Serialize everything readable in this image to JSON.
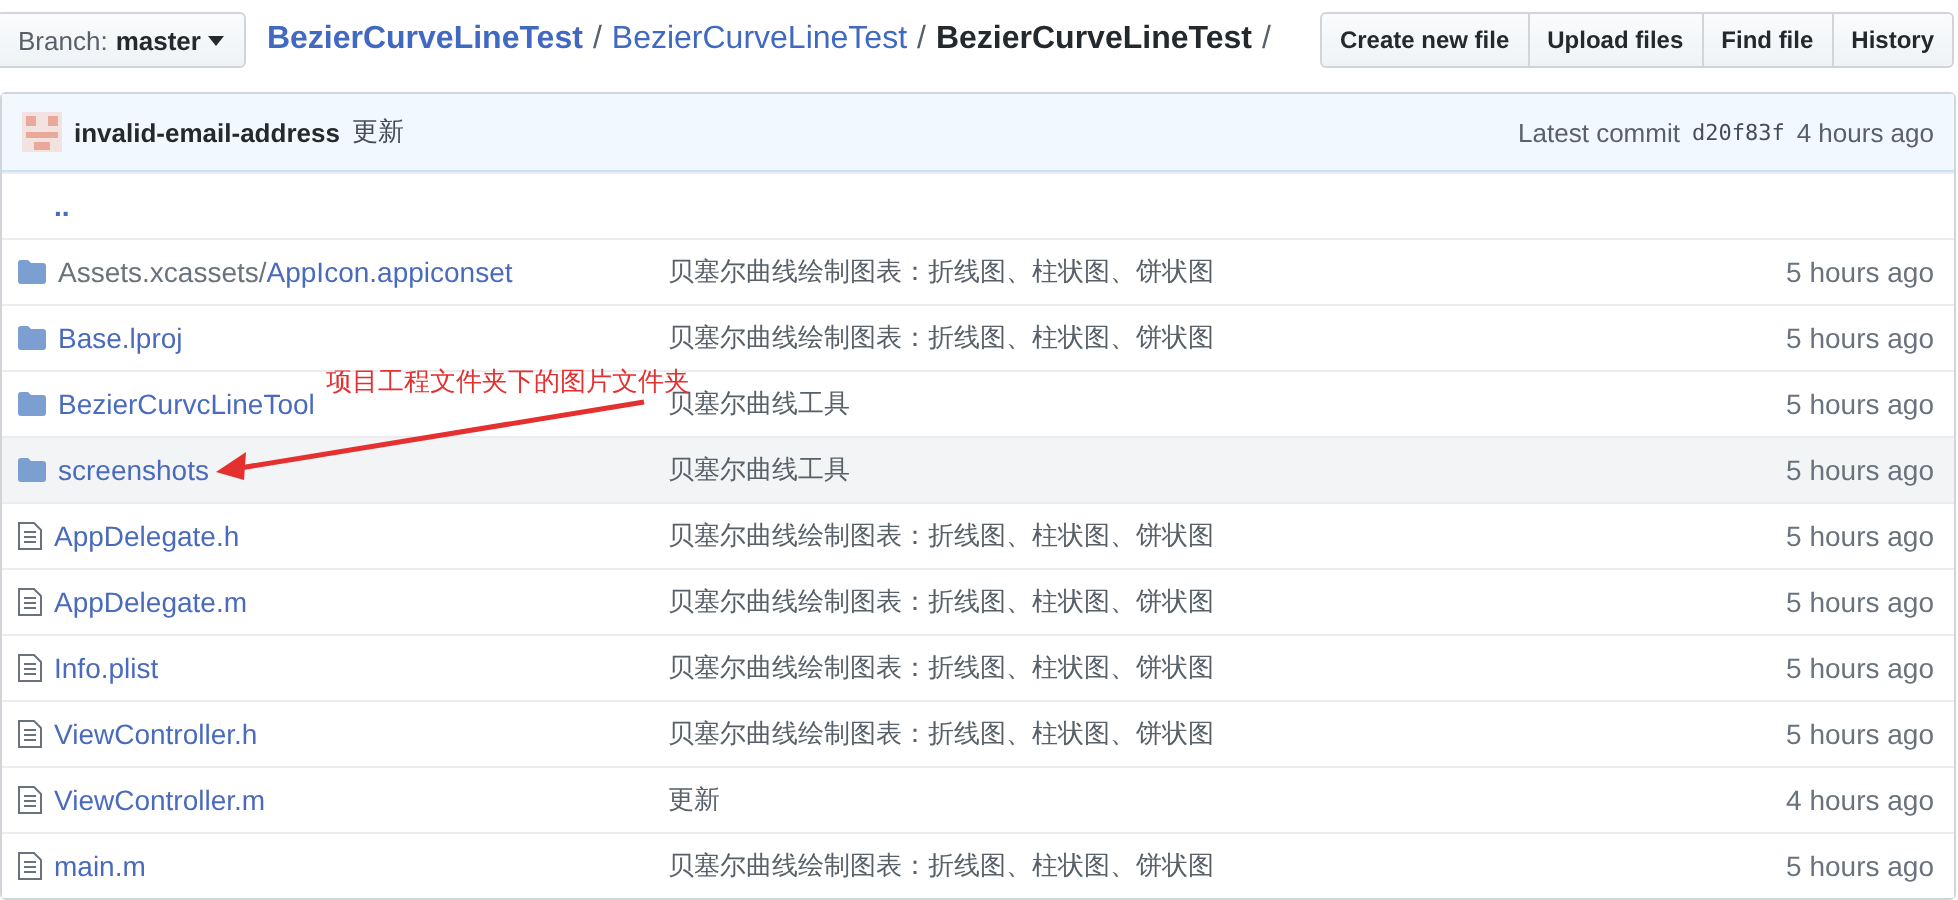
{
  "branch": {
    "label": "Branch:",
    "value": "master"
  },
  "breadcrumb": [
    {
      "text": "BezierCurveLineTest",
      "kind": "link"
    },
    {
      "text": "/",
      "kind": "sep"
    },
    {
      "text": "BezierCurveLineTest",
      "kind": "link"
    },
    {
      "text": "/",
      "kind": "sep"
    },
    {
      "text": "BezierCurveLineTest",
      "kind": "current"
    },
    {
      "text": "/",
      "kind": "sep"
    }
  ],
  "actions": [
    "Create new file",
    "Upload files",
    "Find file",
    "History"
  ],
  "commit": {
    "author": "invalid-email-address",
    "message": "更新",
    "label": "Latest commit",
    "sha": "d20f83f",
    "age": "4 hours ago"
  },
  "parent": "..",
  "files": [
    {
      "kind": "folder",
      "prefix": "Assets.xcassets/",
      "name": "AppIcon.appiconset",
      "message": "贝塞尔曲线绘制图表：折线图、柱状图、饼状图",
      "age": "5 hours ago",
      "hovered": false
    },
    {
      "kind": "folder",
      "name": "Base.lproj",
      "message": "贝塞尔曲线绘制图表：折线图、柱状图、饼状图",
      "age": "5 hours ago",
      "hovered": false
    },
    {
      "kind": "folder",
      "name": "BezierCurvcLineTool",
      "message": "贝塞尔曲线工具",
      "age": "5 hours ago",
      "hovered": false
    },
    {
      "kind": "folder",
      "name": "screenshots",
      "message": "贝塞尔曲线工具",
      "age": "5 hours ago",
      "hovered": true
    },
    {
      "kind": "file",
      "name": "AppDelegate.h",
      "message": "贝塞尔曲线绘制图表：折线图、柱状图、饼状图",
      "age": "5 hours ago",
      "hovered": false
    },
    {
      "kind": "file",
      "name": "AppDelegate.m",
      "message": "贝塞尔曲线绘制图表：折线图、柱状图、饼状图",
      "age": "5 hours ago",
      "hovered": false
    },
    {
      "kind": "file",
      "name": "Info.plist",
      "message": "贝塞尔曲线绘制图表：折线图、柱状图、饼状图",
      "age": "5 hours ago",
      "hovered": false
    },
    {
      "kind": "file",
      "name": "ViewController.h",
      "message": "贝塞尔曲线绘制图表：折线图、柱状图、饼状图",
      "age": "5 hours ago",
      "hovered": false
    },
    {
      "kind": "file",
      "name": "ViewController.m",
      "message": "更新",
      "age": "4 hours ago",
      "hovered": false
    },
    {
      "kind": "file",
      "name": "main.m",
      "message": "贝塞尔曲线绘制图表：折线图、柱状图、饼状图",
      "age": "5 hours ago",
      "hovered": false
    }
  ],
  "annotation": {
    "text": "项目工程文件夹下的图片文件夹"
  }
}
